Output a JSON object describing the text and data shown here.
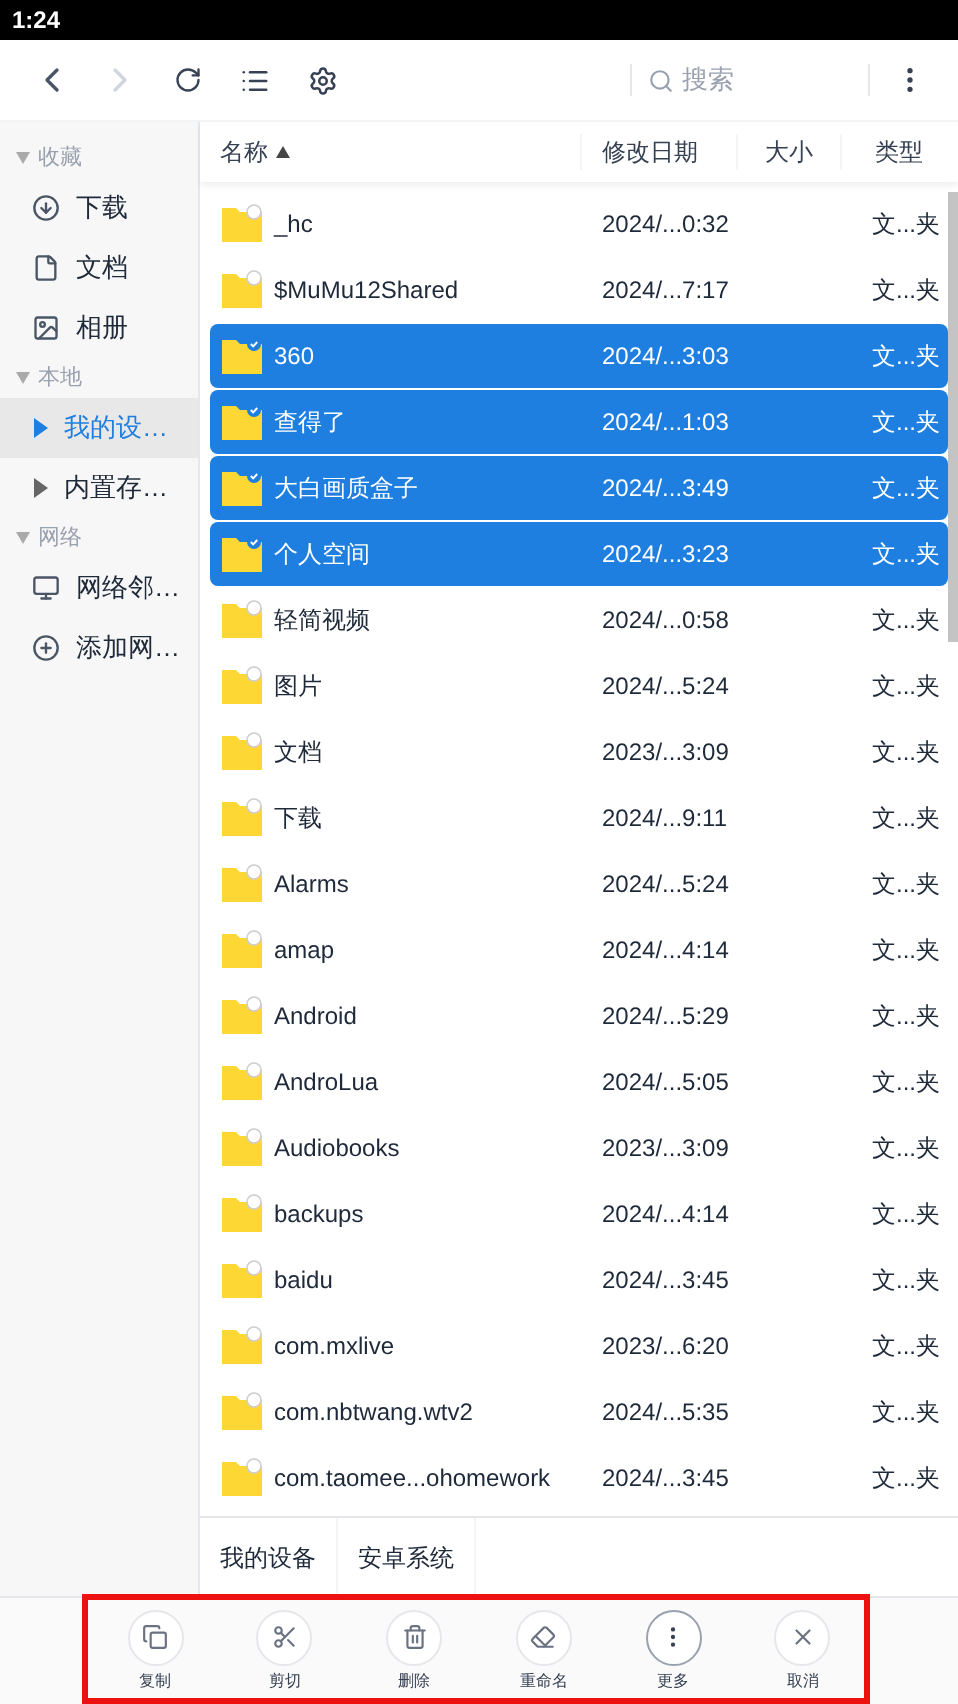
{
  "status_bar": {
    "time": "1:24"
  },
  "toolbar": {
    "search": {
      "placeholder": "搜索"
    }
  },
  "sidebar": {
    "sections": [
      {
        "title": "收藏",
        "expanded": true,
        "items": [
          {
            "label": "下载",
            "kind": "download",
            "selected": false
          },
          {
            "label": "文档",
            "kind": "doc",
            "selected": false
          },
          {
            "label": "相册",
            "kind": "image",
            "selected": false
          }
        ]
      },
      {
        "title": "本地",
        "expanded": true,
        "items": [
          {
            "label": "我的设…",
            "kind": "caret",
            "selected": true
          },
          {
            "label": "内置存…",
            "kind": "caret",
            "selected": false
          }
        ]
      },
      {
        "title": "网络",
        "expanded": true,
        "items": [
          {
            "label": "网络邻…",
            "kind": "monitor",
            "selected": false
          },
          {
            "label": "添加网…",
            "kind": "plus",
            "selected": false
          }
        ]
      }
    ]
  },
  "table": {
    "columns": [
      {
        "label": "名称",
        "sorted": true
      },
      {
        "label": "修改日期",
        "sorted": false
      },
      {
        "label": "大小",
        "sorted": false
      },
      {
        "label": "类型",
        "sorted": false
      }
    ],
    "rows": [
      {
        "name": "_hc",
        "date": "2024/...0:32",
        "type": "文...夹",
        "selected": false
      },
      {
        "name": "$MuMu12Shared",
        "date": "2024/...7:17",
        "type": "文...夹",
        "selected": false
      },
      {
        "name": "360",
        "date": "2024/...3:03",
        "type": "文...夹",
        "selected": true
      },
      {
        "name": "查得了",
        "date": "2024/...1:03",
        "type": "文...夹",
        "selected": true
      },
      {
        "name": "大白画质盒子",
        "date": "2024/...3:49",
        "type": "文...夹",
        "selected": true
      },
      {
        "name": "个人空间",
        "date": "2024/...3:23",
        "type": "文...夹",
        "selected": true
      },
      {
        "name": "轻简视频",
        "date": "2024/...0:58",
        "type": "文...夹",
        "selected": false
      },
      {
        "name": "图片",
        "date": "2024/...5:24",
        "type": "文...夹",
        "selected": false
      },
      {
        "name": "文档",
        "date": "2023/...3:09",
        "type": "文...夹",
        "selected": false
      },
      {
        "name": "下载",
        "date": "2024/...9:11",
        "type": "文...夹",
        "selected": false
      },
      {
        "name": "Alarms",
        "date": "2024/...5:24",
        "type": "文...夹",
        "selected": false
      },
      {
        "name": "amap",
        "date": "2024/...4:14",
        "type": "文...夹",
        "selected": false
      },
      {
        "name": "Android",
        "date": "2024/...5:29",
        "type": "文...夹",
        "selected": false
      },
      {
        "name": "AndroLua",
        "date": "2024/...5:05",
        "type": "文...夹",
        "selected": false
      },
      {
        "name": "Audiobooks",
        "date": "2023/...3:09",
        "type": "文...夹",
        "selected": false
      },
      {
        "name": "backups",
        "date": "2024/...4:14",
        "type": "文...夹",
        "selected": false
      },
      {
        "name": "baidu",
        "date": "2024/...3:45",
        "type": "文...夹",
        "selected": false
      },
      {
        "name": "com.mxlive",
        "date": "2023/...6:20",
        "type": "文...夹",
        "selected": false
      },
      {
        "name": "com.nbtwang.wtv2",
        "date": "2024/...5:35",
        "type": "文...夹",
        "selected": false
      },
      {
        "name": "com.taomee...ohomework",
        "date": "2024/...3:45",
        "type": "文...夹",
        "selected": false
      }
    ]
  },
  "breadcrumb": [
    {
      "label": "我的设备"
    },
    {
      "label": "安卓系统"
    }
  ],
  "actions": [
    {
      "label": "复制",
      "kind": "copy",
      "emphasized": false
    },
    {
      "label": "剪切",
      "kind": "cut",
      "emphasized": false
    },
    {
      "label": "删除",
      "kind": "trash",
      "emphasized": false
    },
    {
      "label": "重命名",
      "kind": "eraser",
      "emphasized": false
    },
    {
      "label": "更多",
      "kind": "more",
      "emphasized": true
    },
    {
      "label": "取消",
      "kind": "close",
      "emphasized": false
    }
  ],
  "highlight": {
    "shown": true
  }
}
